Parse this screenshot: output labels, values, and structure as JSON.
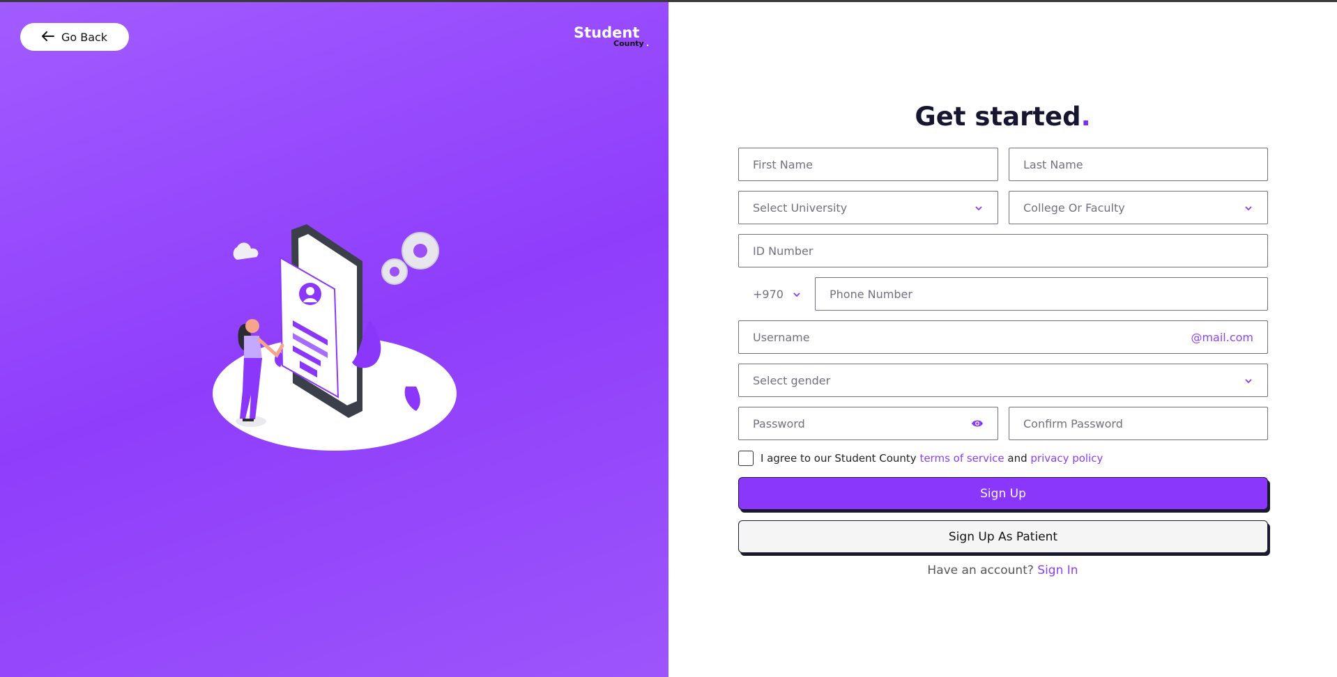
{
  "nav": {
    "back_label": "Go Back"
  },
  "brand": {
    "line1": "Student",
    "line2": "County",
    "dot": "."
  },
  "form": {
    "title": "Get started",
    "title_dot": ".",
    "first_name_placeholder": "First Name",
    "last_name_placeholder": "Last Name",
    "university_placeholder": "Select University",
    "college_placeholder": "College Or Faculty",
    "id_placeholder": "ID Number",
    "country_code": "+970",
    "phone_placeholder": "Phone Number",
    "username_placeholder": "Username",
    "username_suffix": "@mail.com",
    "gender_placeholder": "Select gender",
    "password_placeholder": "Password",
    "confirm_password_placeholder": "Confirm Password",
    "agree_text": "I agree to our Student County",
    "terms_link": "terms of service",
    "and_text": "and",
    "privacy_link": "privacy policy",
    "signup_label": "Sign Up",
    "signup_patient_label": "Sign Up As Patient",
    "have_account_text": "Have an account?",
    "signin_link": "Sign In"
  },
  "colors": {
    "accent": "#8a36fb",
    "panel_bg": "#9747ff",
    "dark": "#161630"
  },
  "icons": [
    "arrow-left-icon",
    "chevron-down-icon",
    "eye-icon",
    "checkbox-icon"
  ]
}
